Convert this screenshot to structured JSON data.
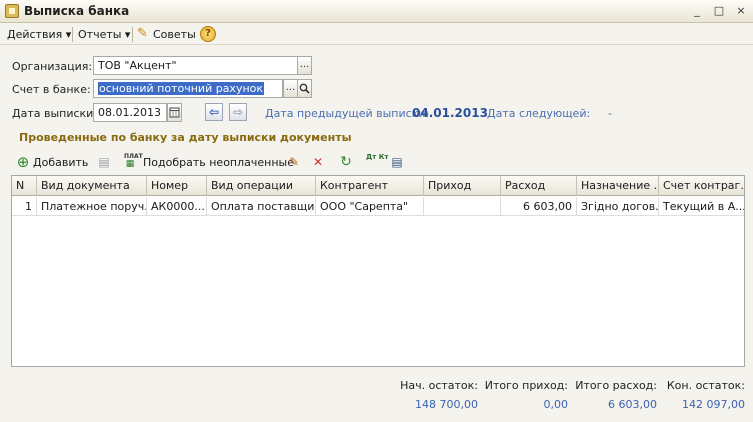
{
  "window": {
    "title": "Выписка банка",
    "controls": [
      "_",
      "□",
      "×"
    ]
  },
  "menu": {
    "actions": "Действия",
    "reports": "Отчеты",
    "tips": "Советы",
    "help": "?"
  },
  "form": {
    "organization_label": "Организация:",
    "organization_value": "ТОВ \"Акцент\"",
    "account_label": "Счет в банке:",
    "account_value": "основний поточний рахунок",
    "date_label": "Дата выписки:",
    "date_value": "08.01.2013",
    "prev_label": "Дата предыдущей выписки:",
    "prev_value": "04.01.2013",
    "next_label": "Дата следующей:",
    "next_value": "-",
    "ellipsis": "..."
  },
  "section_title": "Проведенные по банку за дату выписки документы",
  "table_toolbar": {
    "add": "Добавить",
    "pick_unpaid": "Подобрать неоплаченные",
    "plat_caption": "ПЛАТ",
    "dt_kt_caption": "Дт Кт"
  },
  "table": {
    "columns": [
      "N",
      "Вид документа",
      "Номер",
      "Вид операции",
      "Контрагент",
      "Приход",
      "Расход",
      "Назначение ...",
      "Счет контраг..."
    ],
    "rows": [
      [
        "1",
        "Платежное поруч...",
        "АК0000...",
        "Оплата поставщи...",
        "ООО \"Сарепта\"",
        "",
        "6 603,00",
        "Згідно догов...",
        "Текущий в А..."
      ]
    ]
  },
  "totals": {
    "start_label": "Нач. остаток:",
    "start_value": "148 700,00",
    "in_label": "Итого приход:",
    "in_value": "0,00",
    "out_label": "Итого расход:",
    "out_value": "6 603,00",
    "end_label": "Кон. остаток:",
    "end_value": "142 097,00"
  }
}
